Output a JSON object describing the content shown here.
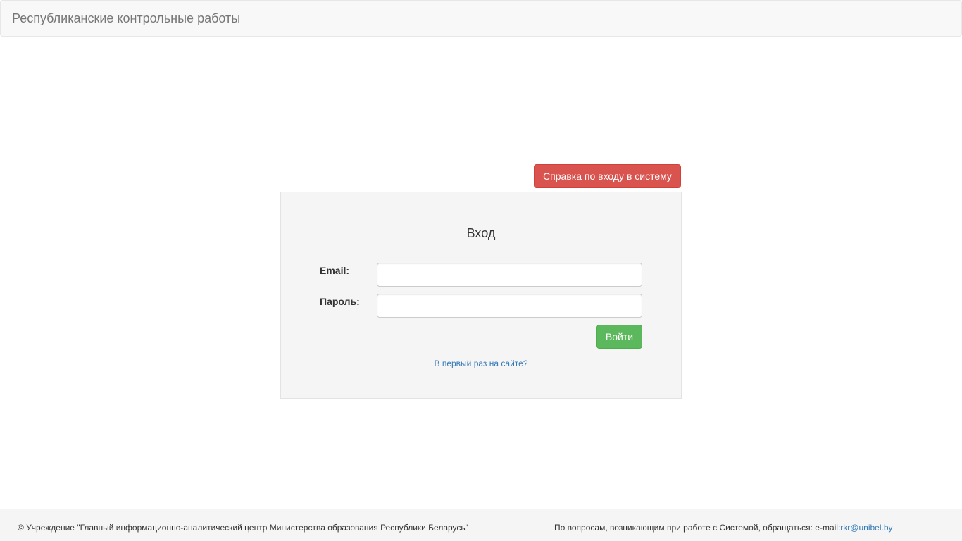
{
  "navbar": {
    "brand": "Республиканские контрольные работы"
  },
  "help_button": {
    "label": "Справка по входу в систему"
  },
  "login": {
    "title": "Вход",
    "email_label": "Email:",
    "email_value": "",
    "password_label": "Пароль:",
    "password_value": "",
    "submit_label": "Войти",
    "first_time_link": "В первый раз на сайте?"
  },
  "footer": {
    "copyright": "© Учреждение \"Главный информационно-аналитический центр Министерства образования Республики Беларусь\"",
    "contact_text": "По вопросам, возникающим при работе с Системой, обращаться: e-mail:",
    "contact_email": "rkr@unibel.by"
  },
  "colors": {
    "danger": "#d9534f",
    "success": "#5cb85c",
    "link": "#337ab7",
    "navbar_bg": "#f8f8f8",
    "well_bg": "#f5f5f5"
  }
}
